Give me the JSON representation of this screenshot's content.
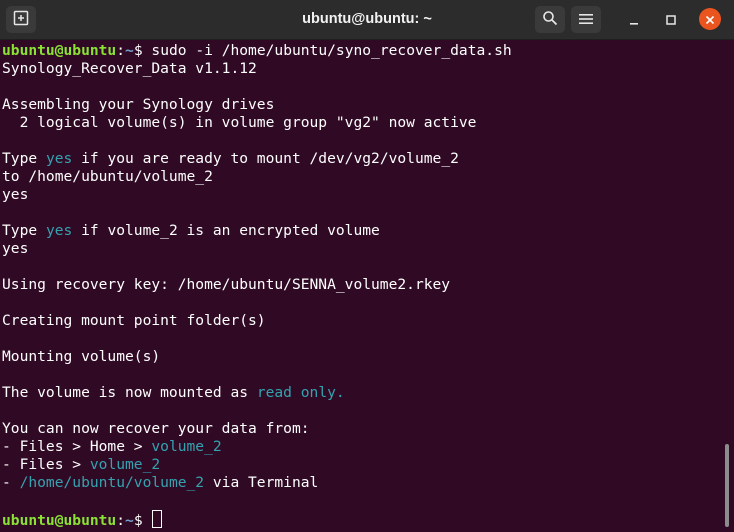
{
  "window": {
    "title": "ubuntu@ubuntu: ~"
  },
  "titlebar_icons": {
    "new_tab": "new-tab-icon",
    "search": "search-icon",
    "menu": "hamburger-menu-icon",
    "minimize": "minimize-icon",
    "maximize": "maximize-icon",
    "close": "close-icon"
  },
  "colors": {
    "background": "#300a24",
    "prompt_user": "#8ae234",
    "prompt_path": "#729fcf",
    "highlight": "#34a2b0",
    "close_button": "#e9541f"
  },
  "prompt": {
    "user": "ubuntu@ubuntu",
    "sep": ":",
    "path": "~",
    "symbol": "$ "
  },
  "command": "sudo -i /home/ubuntu/syno_recover_data.sh",
  "output": {
    "version": "Synology_Recover_Data v1.1.12",
    "assembling": "Assembling your Synology drives",
    "lv_active": "  2 logical volume(s) in volume group \"vg2\" now active",
    "type1_pre": "Type ",
    "type1_yes": "yes",
    "type1_post": " if you are ready to mount /dev/vg2/volume_2",
    "to_path": "to /home/ubuntu/volume_2",
    "answer1": "yes",
    "type2_pre": "Type ",
    "type2_yes": "yes",
    "type2_post": " if volume_2 is an encrypted volume",
    "answer2": "yes",
    "recovery_key": "Using recovery key: /home/ubuntu/SENNA_volume2.rkey",
    "creating": "Creating mount point folder(s)",
    "mounting": "Mounting volume(s)",
    "mounted_pre": "The volume is now mounted as ",
    "mounted_ro": "read only.",
    "recover_from": "You can now recover your data from:",
    "opt1_pre": "- Files > Home > ",
    "opt1_link": "volume_2",
    "opt2_pre": "- Files > ",
    "opt2_link": "volume_2",
    "opt3_pre": "- ",
    "opt3_link": "/home/ubuntu/volume_2",
    "opt3_post": " via Terminal"
  }
}
